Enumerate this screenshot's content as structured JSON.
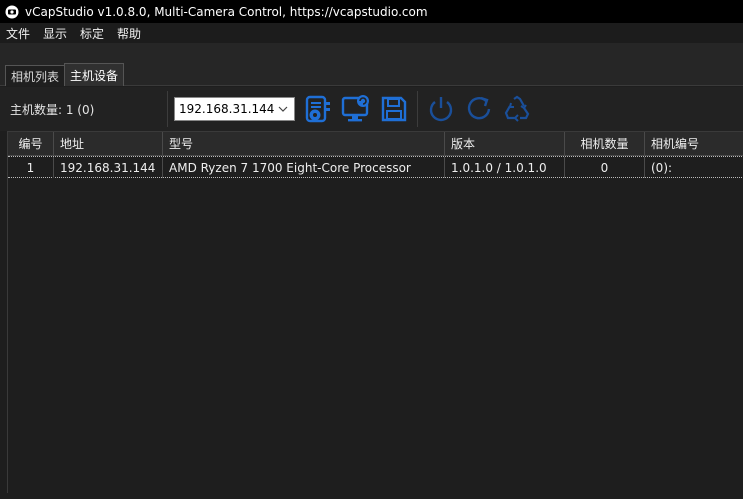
{
  "window": {
    "title": "vCapStudio v1.0.8.0, Multi-Camera Control, https://vcapstudio.com"
  },
  "menu": [
    "文件",
    "显示",
    "标定",
    "帮助"
  ],
  "tabs": [
    {
      "label": "相机列表",
      "active": false
    },
    {
      "label": "主机设备",
      "active": true
    }
  ],
  "toolbar": {
    "host_count": "主机数量: 1   (0)",
    "host_select": "192.168.31.144",
    "icons": [
      "host-connect-icon",
      "monitor-sync-icon",
      "save-icon",
      "power-icon",
      "restart-icon",
      "recycle-icon"
    ],
    "accent": "#1f6fd6"
  },
  "table": {
    "headers": [
      "编号",
      "地址",
      "型号",
      "版本",
      "相机数量",
      "相机编号"
    ],
    "rows": [
      [
        "1",
        "192.168.31.144",
        "AMD Ryzen 7 1700 Eight-Core Processor",
        "1.0.1.0 / 1.0.1.0",
        "0",
        "(0):"
      ]
    ]
  }
}
